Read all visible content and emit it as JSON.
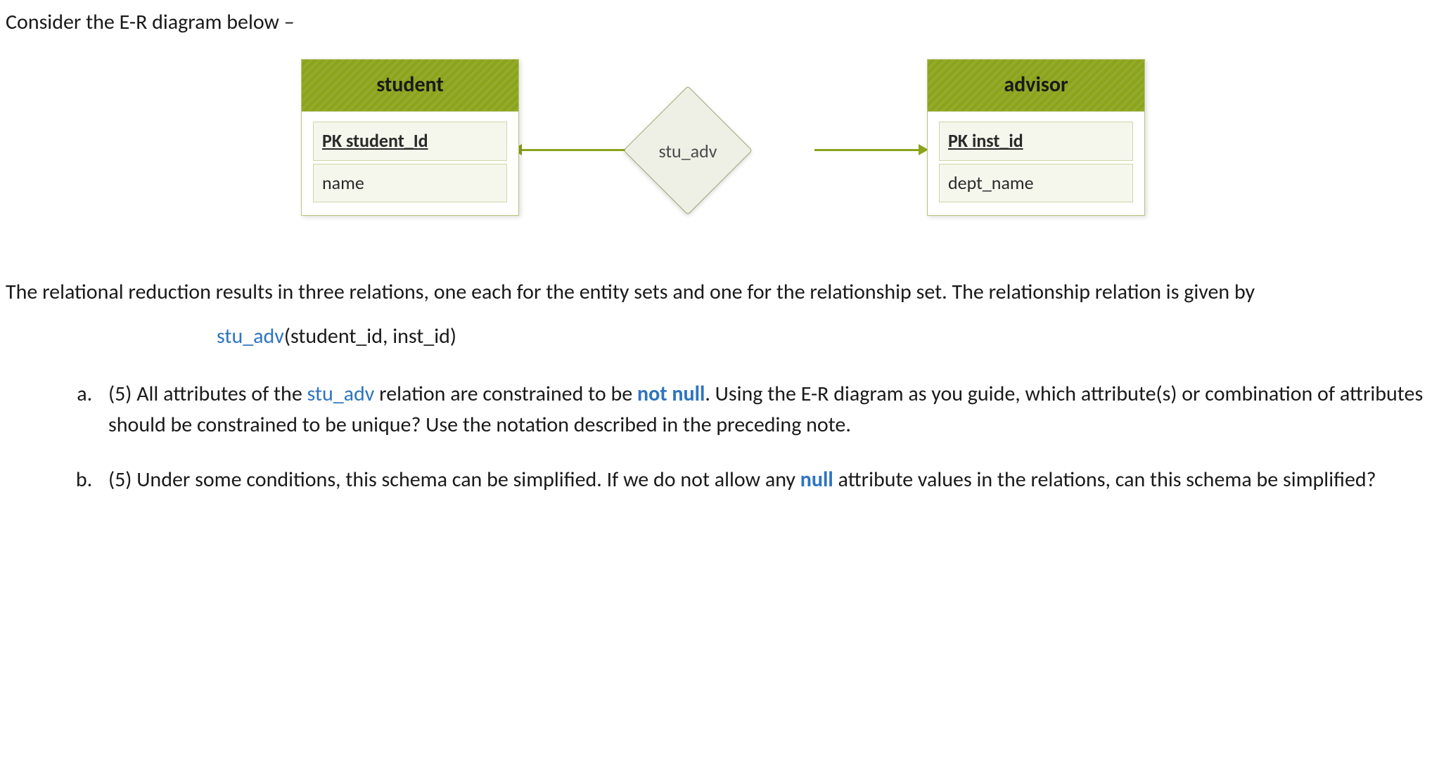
{
  "intro": "Consider the E-R diagram below –",
  "diagram": {
    "entity_left": {
      "title": "student",
      "pk_prefix": "PK ",
      "pk": "student_Id",
      "attr": "name"
    },
    "relationship": "stu_adv",
    "entity_right": {
      "title": "advisor",
      "pk_prefix": "PK ",
      "pk": "inst_id",
      "attr": "dept_name"
    }
  },
  "body_p1": "The relational reduction results in three relations, one each for the entity sets and one for the relationship set. The relationship relation is given by",
  "relation": {
    "name": "stu_adv",
    "args": "(student_id, inst_id)"
  },
  "qa": {
    "points": "(5) ",
    "t1": "All attributes of the ",
    "blue": "stu_adv",
    "t2": " relation are constrained to be ",
    "nn": "not null",
    "t3": ". Using the E-R diagram as you guide, which attribute(s) or combination of attributes should be constrained to be unique? Use the notation described in the preceding note."
  },
  "qb": {
    "points": "(5) ",
    "t1": "Under some conditions, this schema can be simplified. If we do not allow any ",
    "nullword": "null",
    "t2": " attribute values in the relations, can this schema be simplified?"
  }
}
